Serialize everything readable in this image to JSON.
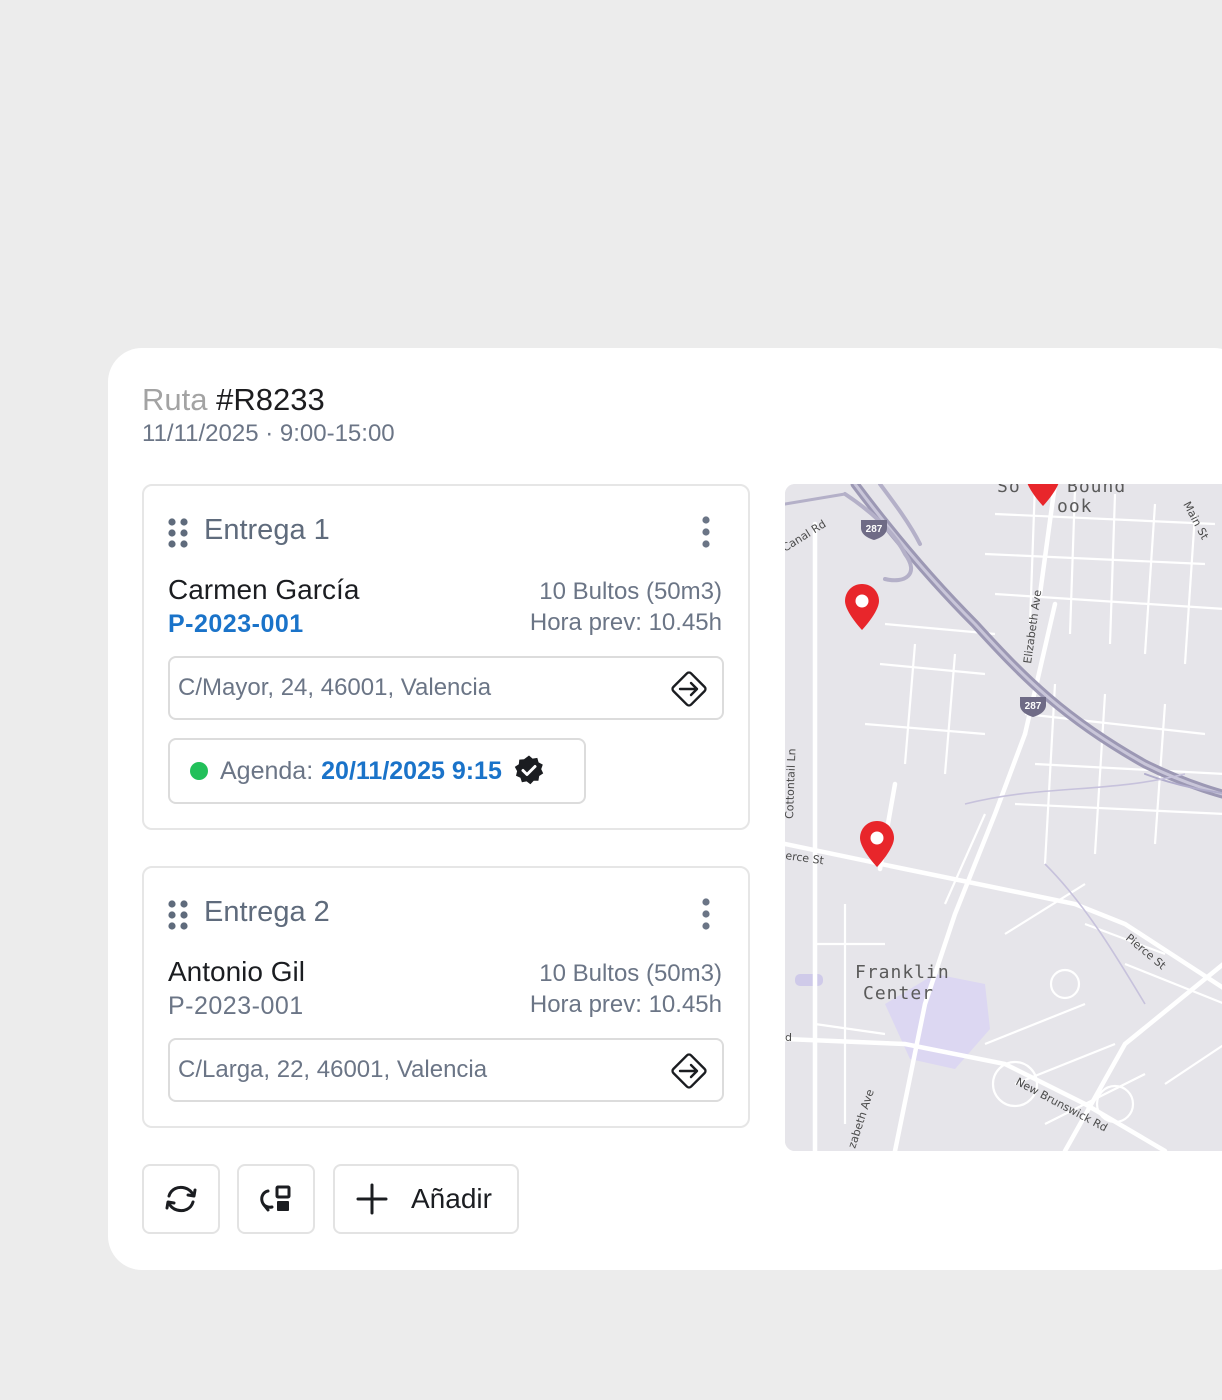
{
  "route": {
    "label": "Ruta",
    "id": "#R8233",
    "schedule": "11/11/2025 · 9:00-15:00"
  },
  "deliveries": [
    {
      "title": "Entrega 1",
      "client": "Carmen García",
      "code": "P-2023-001",
      "packages": "10 Bultos (50m3)",
      "eta": "Hora prev: 10.45h",
      "address": "C/Mayor, 24, 46001, Valencia",
      "agenda": {
        "label": "Agenda:",
        "value": "20/11/2025 9:15",
        "status_color": "#22c05a"
      }
    },
    {
      "title": "Entrega 2",
      "client": "Antonio Gil",
      "code": "P-2023-001",
      "packages": "10 Bultos (50m3)",
      "eta": "Hora prev: 10.45h",
      "address": "C/Larga, 22, 46001, Valencia"
    }
  ],
  "map": {
    "labels": {
      "canal_rd": "Canal Rd",
      "main_st": "Main St",
      "elizabeth_ave": "Elizabeth Ave",
      "elizabeth_ave_2": "zabeth Ave",
      "cottontail_ln": "Cottontail Ln",
      "pierce_st_left": "erce St",
      "pierce_st_right": "Pierce St",
      "franklin": "Franklin",
      "center": "Center",
      "new_brunswick": "New Brunswick Rd",
      "south_bound_1": "So",
      "south_bound_2": "Bound",
      "south_bound_3": "ook",
      "highway_1": "287",
      "highway_2": "287",
      "edge_d": "d"
    },
    "pin_color": "#e8262b"
  },
  "toolbar": {
    "add_label": "Añadir",
    "icons": [
      "refresh-icon",
      "layout-icon",
      "plus-icon"
    ]
  },
  "colors": {
    "accent": "#1a73c9",
    "muted_text": "#6b7586",
    "background": "#ececec"
  }
}
